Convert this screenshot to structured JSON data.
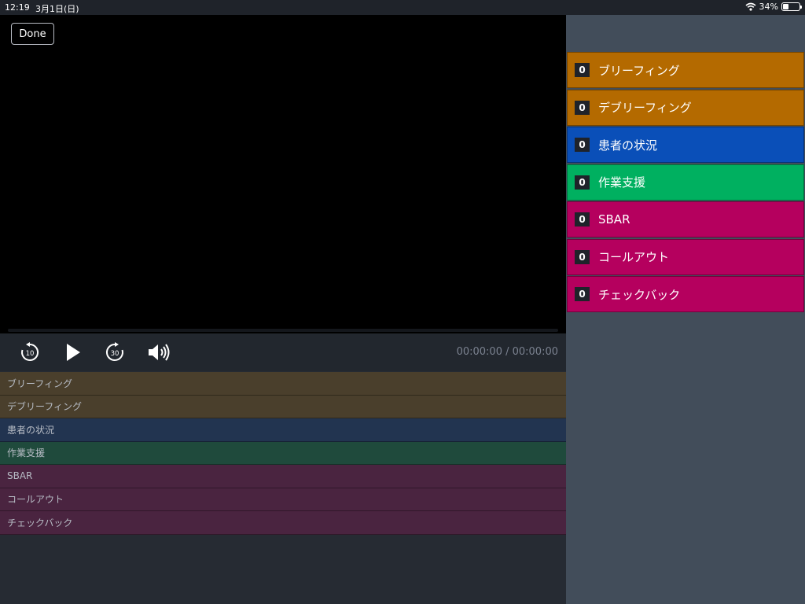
{
  "status_bar": {
    "time": "12:19",
    "date": "3月1日(日)",
    "battery_percent": "34%",
    "battery_level": 0.34
  },
  "player": {
    "done_label": "Done",
    "time_readout": "00:00:00 / 00:00:00",
    "progress": 0,
    "controls": [
      {
        "name": "rewind-10-icon",
        "label": "10"
      },
      {
        "name": "play-icon",
        "label": ""
      },
      {
        "name": "forward-30-icon",
        "label": "30"
      },
      {
        "name": "volume-icon",
        "label": ""
      }
    ]
  },
  "tag_rows": [
    {
      "label": "ブリーフィング",
      "color": "#4a3f2c"
    },
    {
      "label": "デブリーフィング",
      "color": "#4a3f2c"
    },
    {
      "label": "患者の状況",
      "color": "#223450"
    },
    {
      "label": "作業支援",
      "color": "#1f4a3c"
    },
    {
      "label": "SBAR",
      "color": "#4a2440"
    },
    {
      "label": "コールアウト",
      "color": "#4a2440"
    },
    {
      "label": "チェックバック",
      "color": "#4a2440"
    }
  ],
  "side_buttons": [
    {
      "count": "0",
      "label": "ブリーフィング",
      "color": "#b46a00"
    },
    {
      "count": "0",
      "label": "デブリーフィング",
      "color": "#b46a00"
    },
    {
      "count": "0",
      "label": "患者の状況",
      "color": "#0a4fb8"
    },
    {
      "count": "0",
      "label": "作業支援",
      "color": "#00b060"
    },
    {
      "count": "0",
      "label": "SBAR",
      "color": "#b5005e"
    },
    {
      "count": "0",
      "label": "コールアウト",
      "color": "#b5005e"
    },
    {
      "count": "0",
      "label": "チェックバック",
      "color": "#b5005e"
    }
  ]
}
